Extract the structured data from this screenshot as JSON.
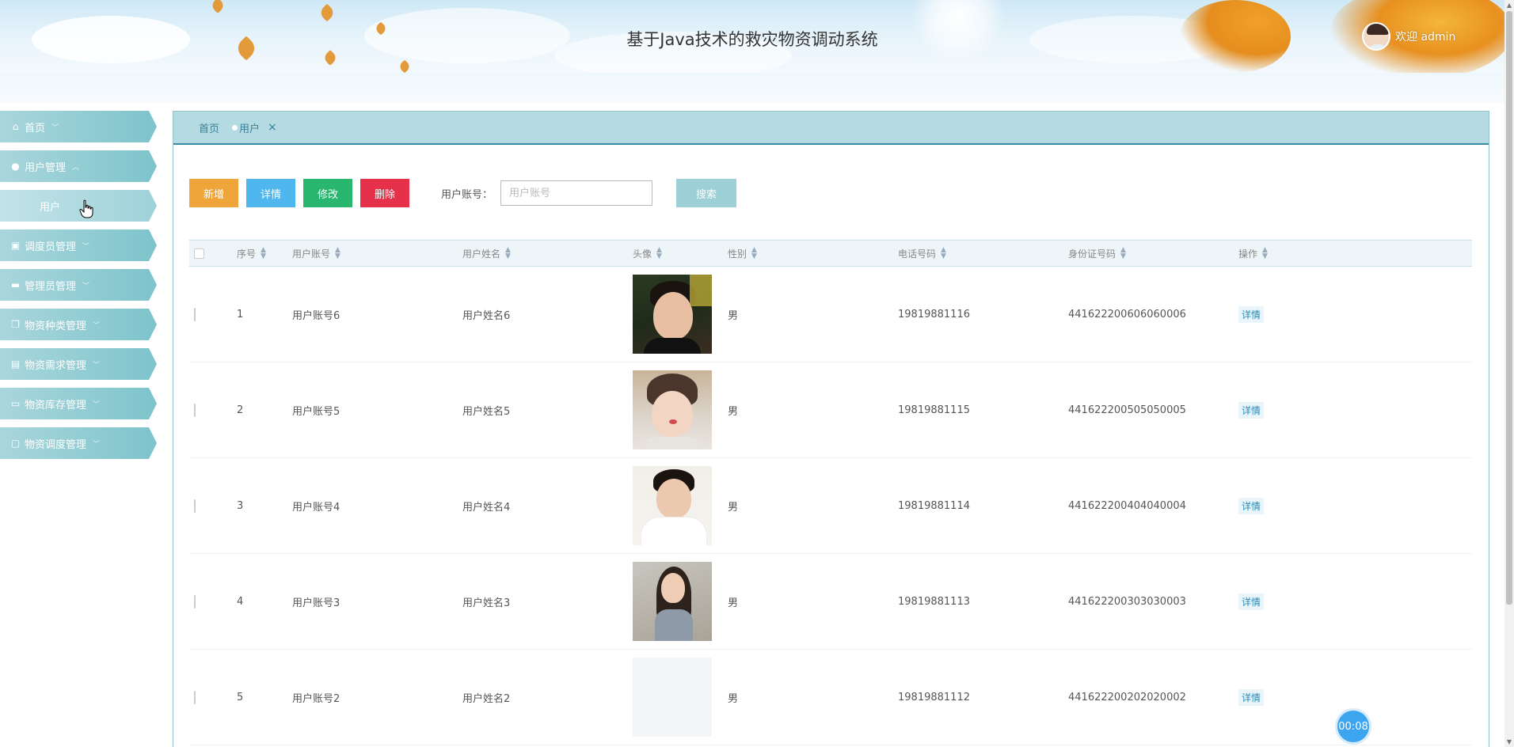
{
  "header": {
    "title": "基于Java技术的救灾物资调动系统",
    "welcome": "欢迎 admin"
  },
  "sidebar": {
    "items": [
      {
        "label": "首页",
        "icon": "home-icon"
      },
      {
        "label": "用户管理",
        "icon": "user-icon"
      },
      {
        "label": "用户",
        "icon": ""
      },
      {
        "label": "调度员管理",
        "icon": "briefcase-icon"
      },
      {
        "label": "管理员管理",
        "icon": "card-icon"
      },
      {
        "label": "物资种类管理",
        "icon": "copy-icon"
      },
      {
        "label": "物资需求管理",
        "icon": "printer-icon"
      },
      {
        "label": "物资库存管理",
        "icon": "folder-icon"
      },
      {
        "label": "物资调度管理",
        "icon": "badge-icon"
      }
    ]
  },
  "tabs": {
    "home": "首页",
    "current": "用户",
    "close": "×"
  },
  "toolbar": {
    "add": "新增",
    "detail": "详情",
    "edit": "修改",
    "delete": "删除",
    "search_label": "用户账号：",
    "search_placeholder": "用户账号",
    "search_button": "搜索"
  },
  "table": {
    "headers": [
      "序号",
      "用户账号",
      "用户姓名",
      "头像",
      "性别",
      "电话号码",
      "身份证号码",
      "操作"
    ],
    "action_label": "详情",
    "rows": [
      {
        "no": "1",
        "account": "用户账号6",
        "name": "用户姓名6",
        "gender": "男",
        "phone": "19819881116",
        "id_card": "441622200606060006"
      },
      {
        "no": "2",
        "account": "用户账号5",
        "name": "用户姓名5",
        "gender": "男",
        "phone": "19819881115",
        "id_card": "441622200505050005"
      },
      {
        "no": "3",
        "account": "用户账号4",
        "name": "用户姓名4",
        "gender": "男",
        "phone": "19819881114",
        "id_card": "441622200404040004"
      },
      {
        "no": "4",
        "account": "用户账号3",
        "name": "用户姓名3",
        "gender": "男",
        "phone": "19819881113",
        "id_card": "441622200303030003"
      },
      {
        "no": "5",
        "account": "用户账号2",
        "name": "用户姓名2",
        "gender": "男",
        "phone": "19819881112",
        "id_card": "441622200202020002"
      }
    ]
  },
  "timer": "00:08",
  "colors": {
    "nav": "#7ec4cc",
    "tab_bar": "#b4dbe2",
    "add": "#f0a53b",
    "detail": "#4fb6ee",
    "edit": "#29b66f",
    "delete": "#e6314a",
    "search": "#9ccfd6"
  }
}
